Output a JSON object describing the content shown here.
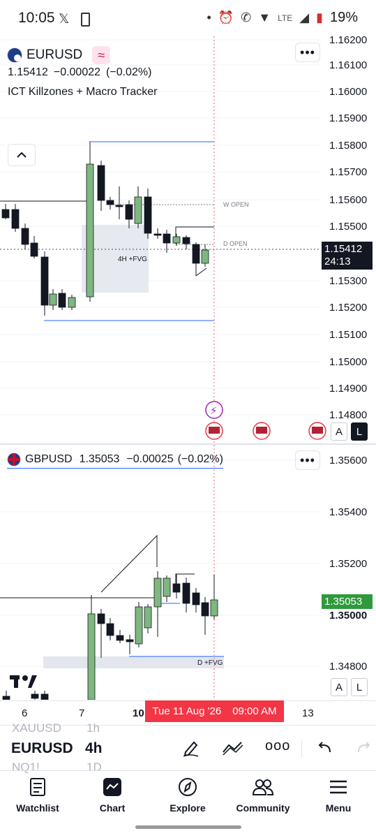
{
  "status_bar": {
    "time": "10:05",
    "battery": "19%",
    "network": "LTE"
  },
  "chart1": {
    "symbol": "EURUSD",
    "price": "1.15412",
    "change": "−0.00022",
    "change_pct": "(−0.02%)",
    "indicator": "ICT Killzones + Macro Tracker",
    "price_axis": [
      "1.16200",
      "1.16100",
      "1.16000",
      "1.15900",
      "1.15800",
      "1.15700",
      "1.15600",
      "1.15500",
      "1.15300",
      "1.15200",
      "1.15100",
      "1.15000",
      "1.14900",
      "1.14800"
    ],
    "current_price_label": "1.15412",
    "countdown": "24:13",
    "labels": {
      "fvg": "4H +FVG",
      "w_open": "W OPEN",
      "d_open": "D OPEN"
    },
    "scale_buttons": [
      "A",
      "L"
    ]
  },
  "chart2": {
    "symbol": "GBPUSD",
    "price": "1.35053",
    "change": "−0.00025",
    "change_pct": "(−0.02%)",
    "price_axis": [
      "1.35600",
      "1.35400",
      "1.35200",
      "1.35000",
      "1.34800"
    ],
    "current_price_label": "1.35053",
    "labels": {
      "fvg": "D +FVG"
    },
    "scale_buttons": [
      "A",
      "L"
    ]
  },
  "time_axis": {
    "labels": [
      "6",
      "7",
      "10",
      "13"
    ],
    "crosshair": {
      "date": "Tue 11 Aug '26",
      "time": "09:00 AM"
    }
  },
  "toolbar": {
    "symbol": "EURUSD",
    "interval": "4h",
    "ghost_above_symbol": "XAUUSD",
    "ghost_below_symbol": "NQ1!",
    "ghost_above_interval": "1h",
    "ghost_below_interval": "1D",
    "icons": [
      "pencil-icon",
      "trend-line-icon",
      "more-icon",
      "undo-icon",
      "redo-icon"
    ]
  },
  "bottom_nav": {
    "items": [
      {
        "label": "Watchlist",
        "icon": "watchlist-icon"
      },
      {
        "label": "Chart",
        "icon": "chart-icon"
      },
      {
        "label": "Explore",
        "icon": "compass-icon"
      },
      {
        "label": "Community",
        "icon": "community-icon"
      },
      {
        "label": "Menu",
        "icon": "menu-icon"
      }
    ]
  },
  "colors": {
    "bull": "#7fb77f",
    "bear": "#131722",
    "red": "#f23645",
    "green": "#2e9a3b",
    "blue_line": "#2962ff"
  }
}
